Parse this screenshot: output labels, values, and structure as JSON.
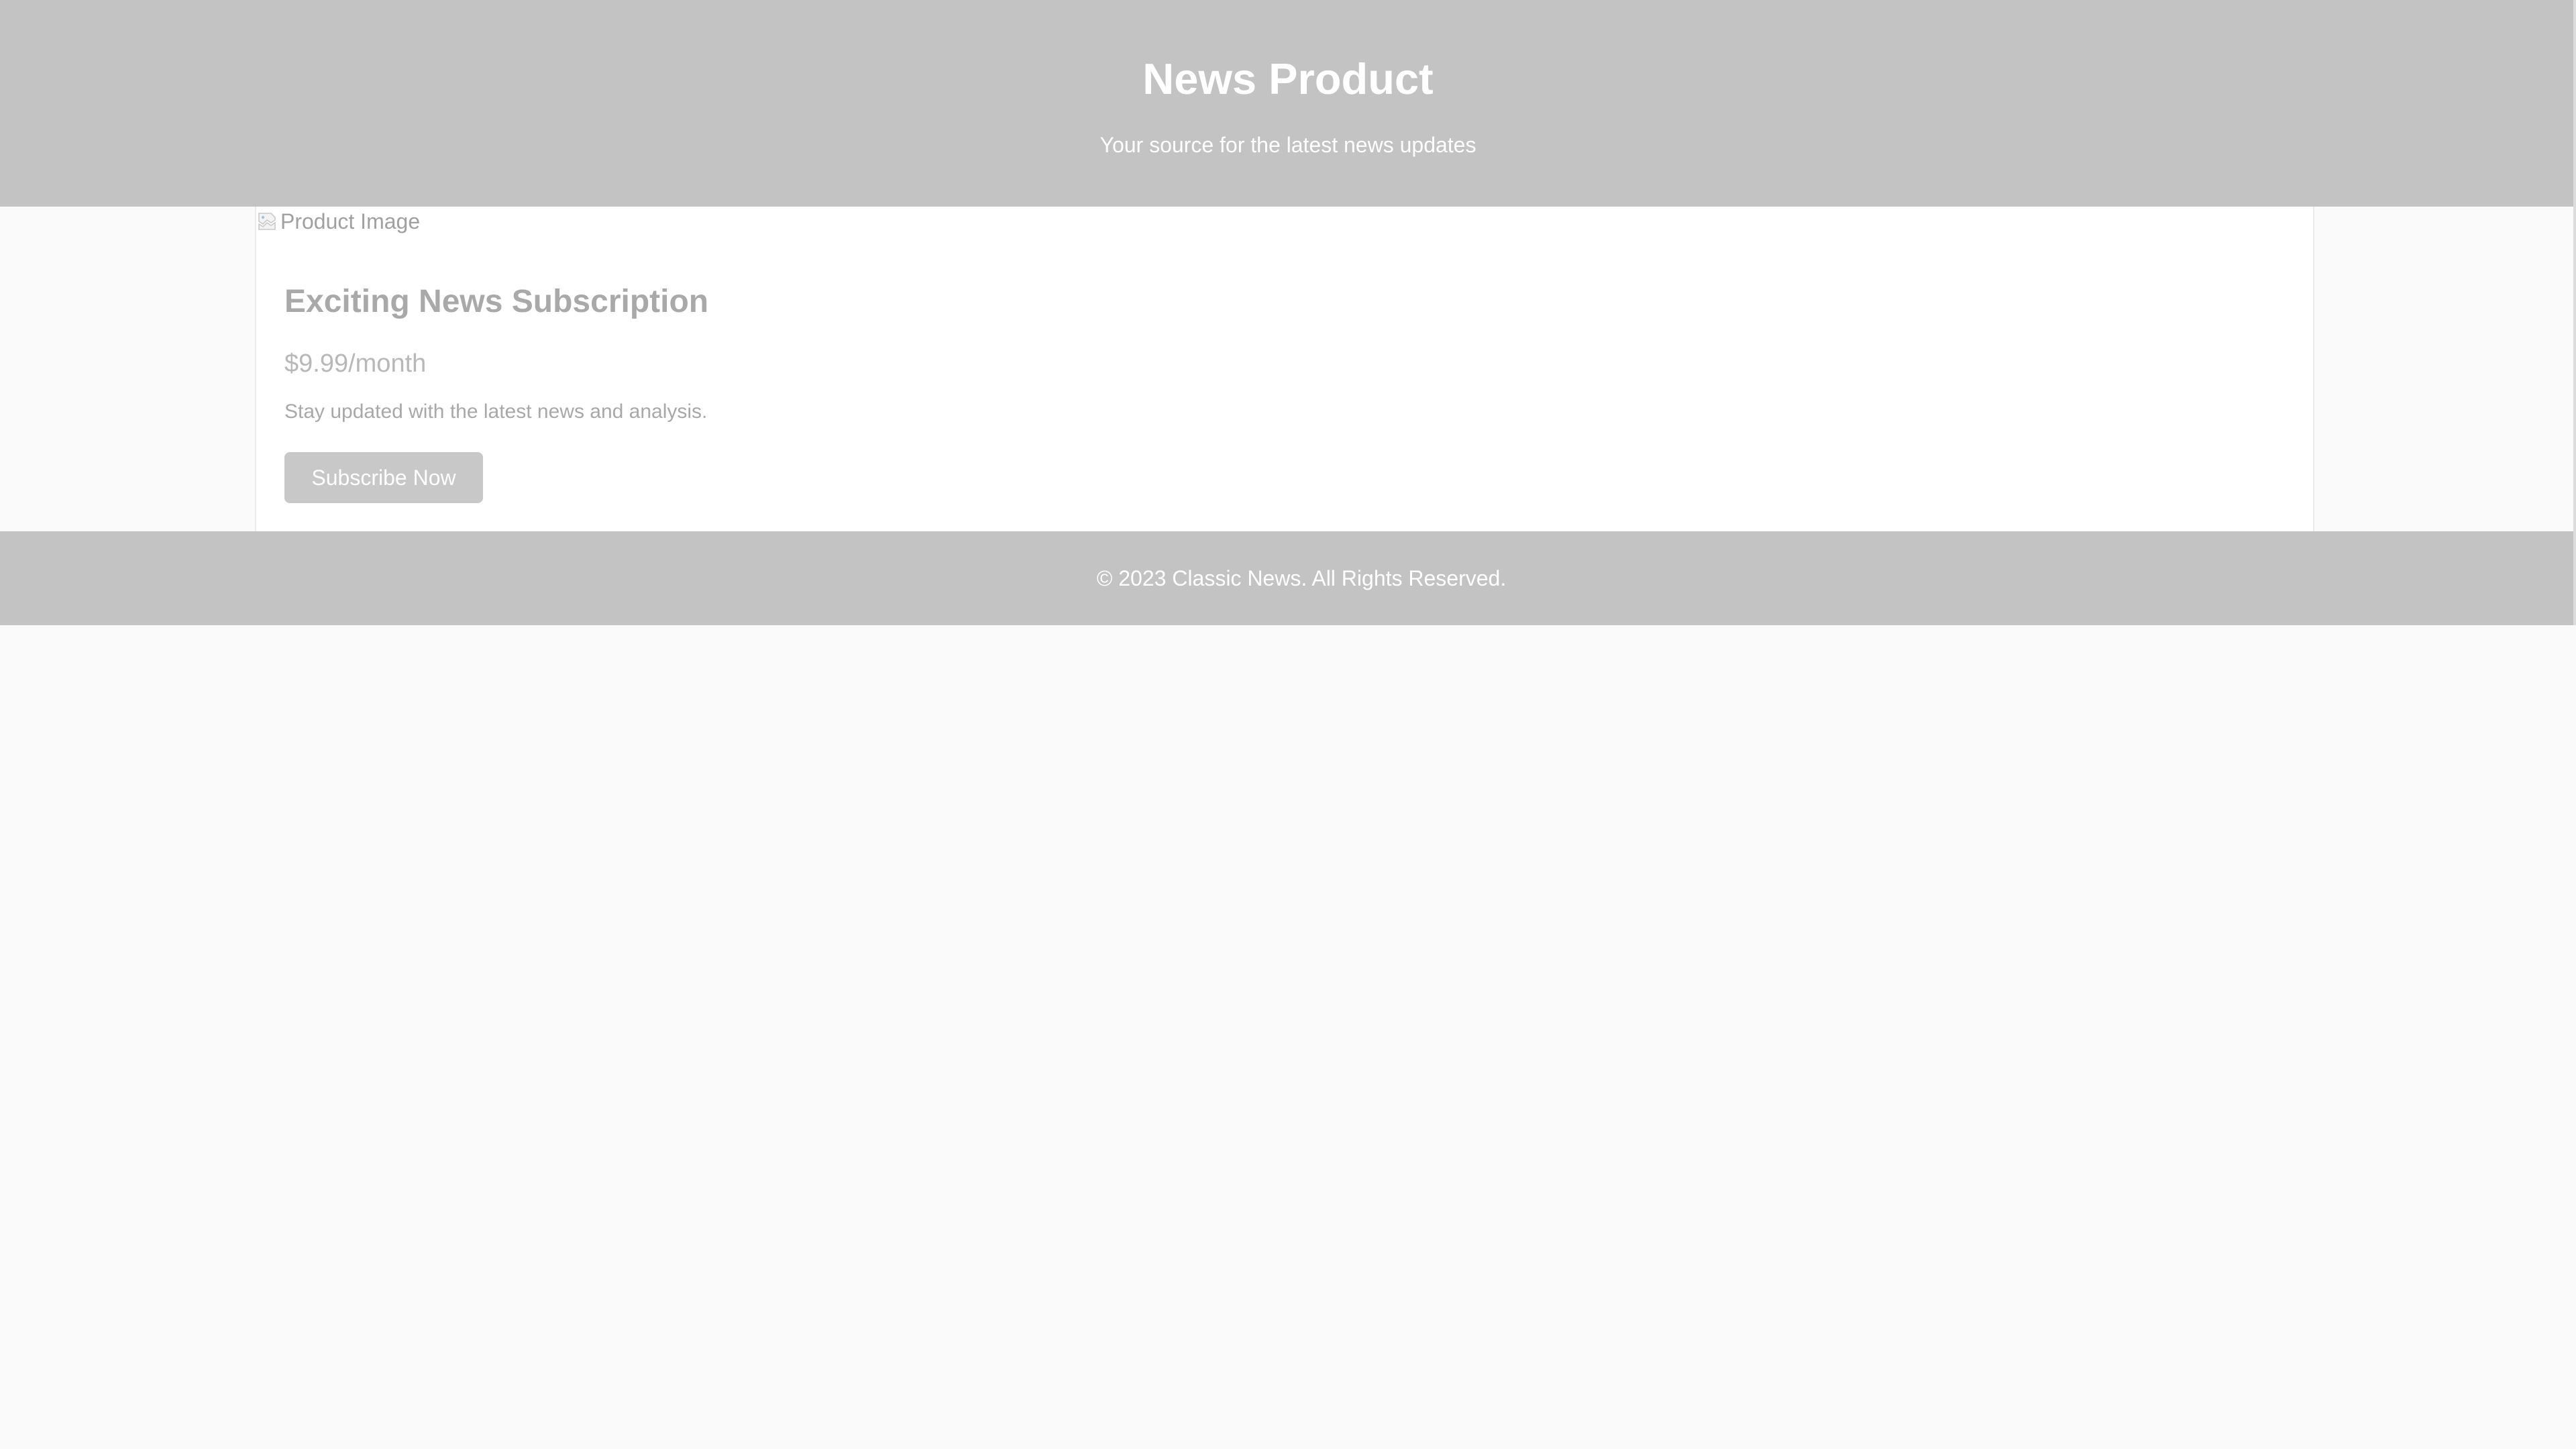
{
  "header": {
    "title": "News Product",
    "subtitle": "Your source for the latest news updates"
  },
  "product": {
    "image_alt": "Product Image",
    "image_icon": "broken-image-icon",
    "title": "Exciting News Subscription",
    "price": "$9.99/month",
    "description": "Stay updated with the latest news and analysis.",
    "button_label": "Subscribe Now"
  },
  "footer": {
    "text": "© 2023 Classic News. All Rights Reserved."
  },
  "colors": {
    "header_bg": "#c3c3c3",
    "page_bg": "#fafafa",
    "card_bg": "#ffffff",
    "button_bg": "#c8c8c8",
    "title_text": "#a9a9a9"
  }
}
